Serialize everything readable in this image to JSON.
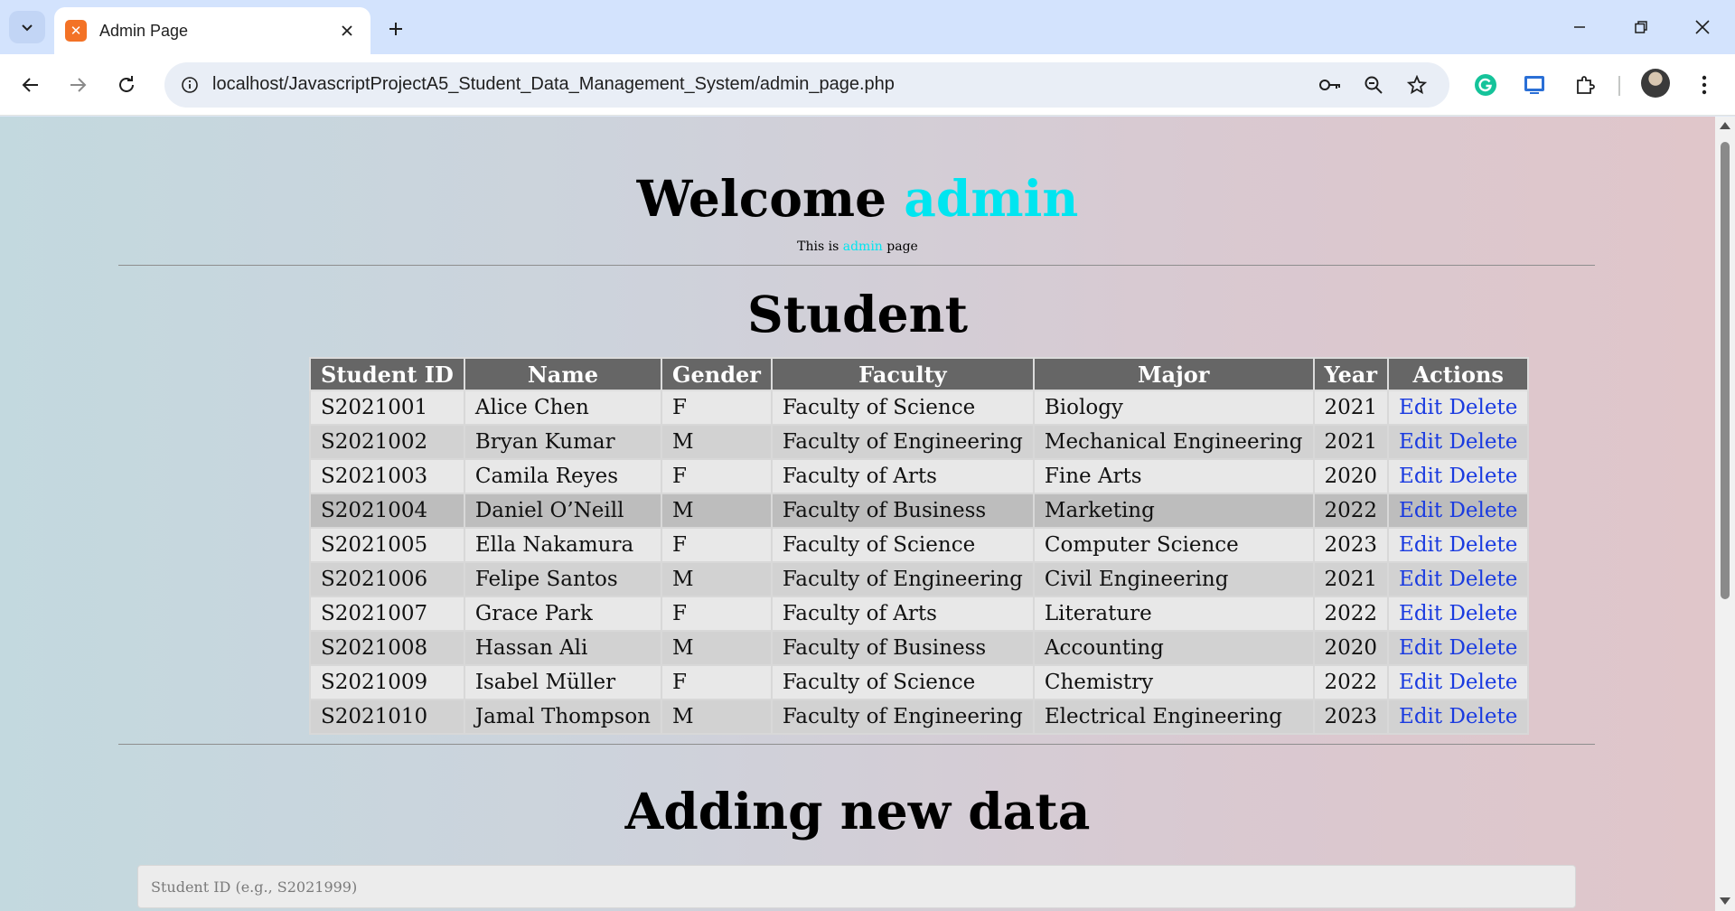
{
  "browser": {
    "tab_title": "Admin Page",
    "url": "localhost/JavascriptProjectA5_Student_Data_Management_System/admin_page.php"
  },
  "page": {
    "welcome_prefix": "Welcome",
    "welcome_user": "admin",
    "subline_prefix": "This is",
    "subline_user": "admin",
    "subline_suffix": "page",
    "accent_color": "#00e5f0",
    "student_title": "Student",
    "add_title": "Adding new data",
    "student_id_placeholder": "Student ID (e.g., S2021999)"
  },
  "table": {
    "headers": [
      "Student ID",
      "Name",
      "Gender",
      "Faculty",
      "Major",
      "Year",
      "Actions"
    ],
    "edit_label": "Edit",
    "delete_label": "Delete",
    "rows": [
      {
        "id": "S2021001",
        "name": "Alice Chen",
        "gender": "F",
        "faculty": "Faculty of Science",
        "major": "Biology",
        "year": "2021"
      },
      {
        "id": "S2021002",
        "name": "Bryan Kumar",
        "gender": "M",
        "faculty": "Faculty of Engineering",
        "major": "Mechanical Engineering",
        "year": "2021"
      },
      {
        "id": "S2021003",
        "name": "Camila Reyes",
        "gender": "F",
        "faculty": "Faculty of Arts",
        "major": "Fine Arts",
        "year": "2020"
      },
      {
        "id": "S2021004",
        "name": "Daniel O’Neill",
        "gender": "M",
        "faculty": "Faculty of Business",
        "major": "Marketing",
        "year": "2022"
      },
      {
        "id": "S2021005",
        "name": "Ella Nakamura",
        "gender": "F",
        "faculty": "Faculty of Science",
        "major": "Computer Science",
        "year": "2023"
      },
      {
        "id": "S2021006",
        "name": "Felipe Santos",
        "gender": "M",
        "faculty": "Faculty of Engineering",
        "major": "Civil Engineering",
        "year": "2021"
      },
      {
        "id": "S2021007",
        "name": "Grace Park",
        "gender": "F",
        "faculty": "Faculty of Arts",
        "major": "Literature",
        "year": "2022"
      },
      {
        "id": "S2021008",
        "name": "Hassan Ali",
        "gender": "M",
        "faculty": "Faculty of Business",
        "major": "Accounting",
        "year": "2020"
      },
      {
        "id": "S2021009",
        "name": "Isabel Müller",
        "gender": "F",
        "faculty": "Faculty of Science",
        "major": "Chemistry",
        "year": "2022"
      },
      {
        "id": "S2021010",
        "name": "Jamal Thompson",
        "gender": "M",
        "faculty": "Faculty of Engineering",
        "major": "Electrical Engineering",
        "year": "2023"
      }
    ]
  }
}
